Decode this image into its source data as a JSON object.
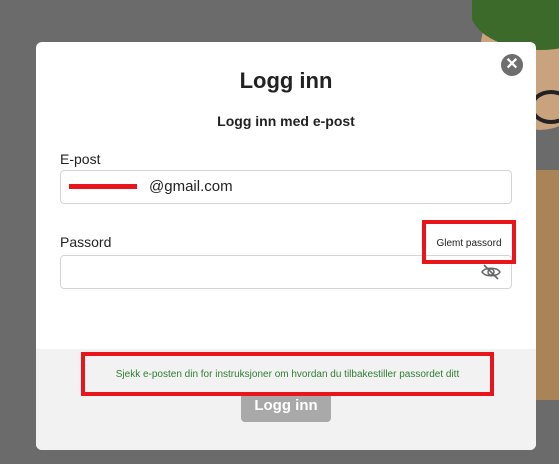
{
  "modal": {
    "title": "Logg inn",
    "subtitle": "Logg inn med e-post",
    "email": {
      "label": "E-post",
      "value": "@gmail.com"
    },
    "password": {
      "label": "Passord",
      "value": ""
    },
    "forgot_password_label": "Glemt passord",
    "notice": "Sjekk e-posten din for instruksjoner om hvordan du tilbakestiller passordet ditt",
    "login_button_label": "Logg inn"
  },
  "colors": {
    "highlight_border": "#e8161b",
    "notice_text": "#2e7d32",
    "button_disabled": "#a9a9a9"
  },
  "icons": [
    "close-icon",
    "eye-slash-icon"
  ]
}
